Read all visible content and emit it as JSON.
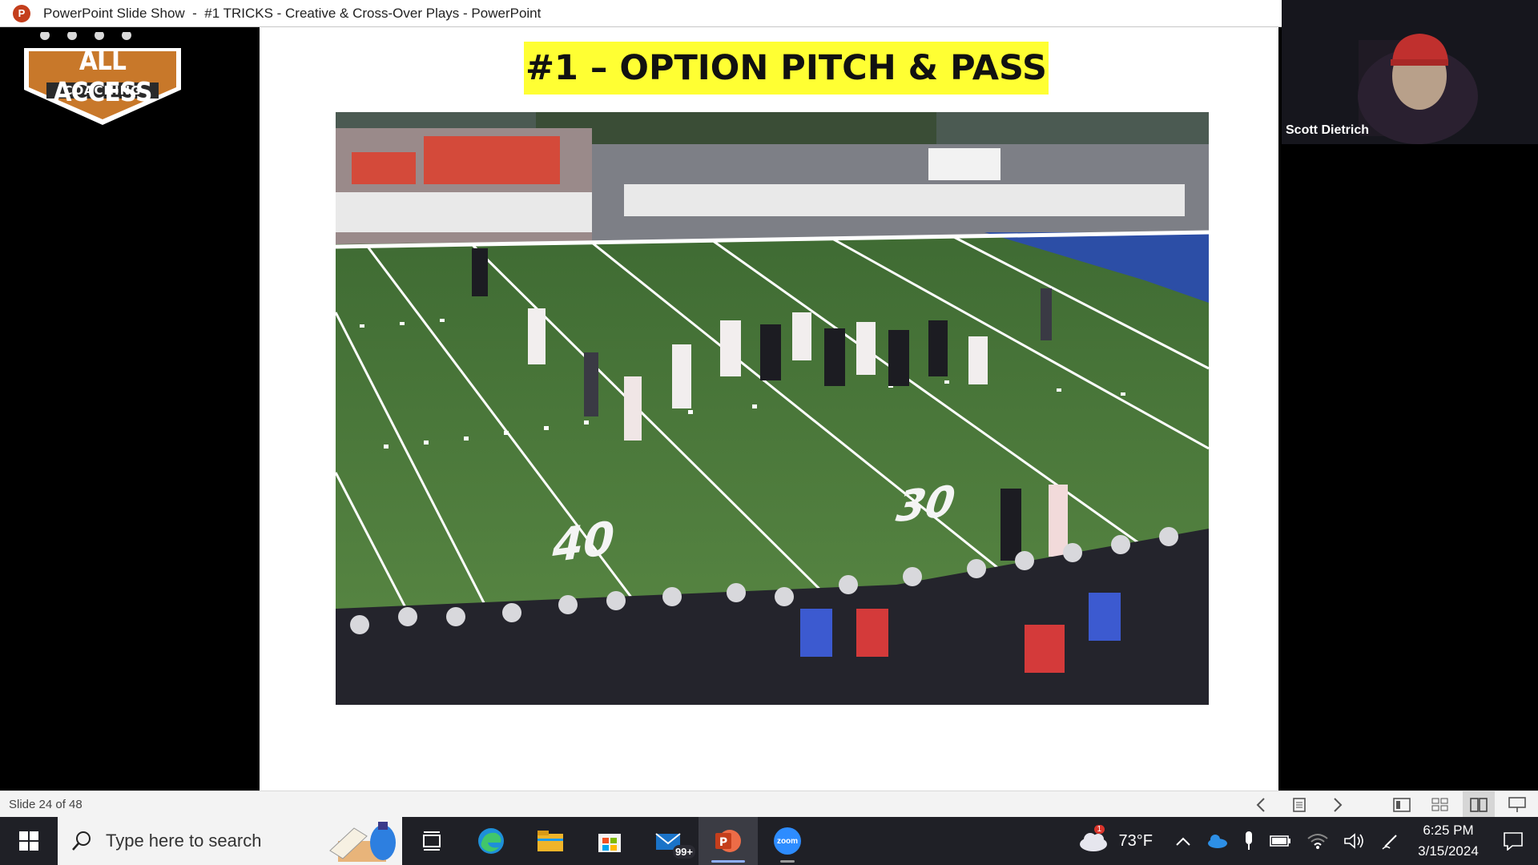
{
  "window": {
    "app_icon": "powerpoint-icon",
    "app_icon_letter": "P",
    "title": "PowerPoint Slide Show  -  #1 TRICKS - Creative & Cross-Over Plays - PowerPoint"
  },
  "logo": {
    "icon": "all-access-coaching-logo",
    "line1": "ALL ACCESS",
    "line2": "COACHING"
  },
  "slide": {
    "title": "#1 – OPTION PITCH & PASS",
    "title_highlight": "#ffff33",
    "video": {
      "icon": "football-game-video",
      "field_numbers": [
        "40",
        "30"
      ]
    }
  },
  "participant": {
    "name": "Scott Dietrich"
  },
  "statusbar": {
    "slide_counter": "Slide 24 of 48",
    "controls": [
      "previous-slide-icon",
      "slide-menu-icon",
      "next-slide-icon",
      "normal-view-icon",
      "slide-sorter-icon",
      "reading-view-icon",
      "slide-show-icon"
    ]
  },
  "taskbar": {
    "search_placeholder": "Type here to search",
    "apps": [
      "task-view-icon",
      "edge-icon",
      "file-explorer-icon",
      "microsoft-store-icon",
      "mail-icon",
      "powerpoint-icon",
      "zoom-icon"
    ],
    "mail_badge": "99+",
    "zoom_label": "zoom",
    "weather": {
      "temperature": "73°F",
      "alert_badge": "1"
    },
    "clock": {
      "time": "6:25 PM",
      "date": "3/15/2024"
    }
  }
}
